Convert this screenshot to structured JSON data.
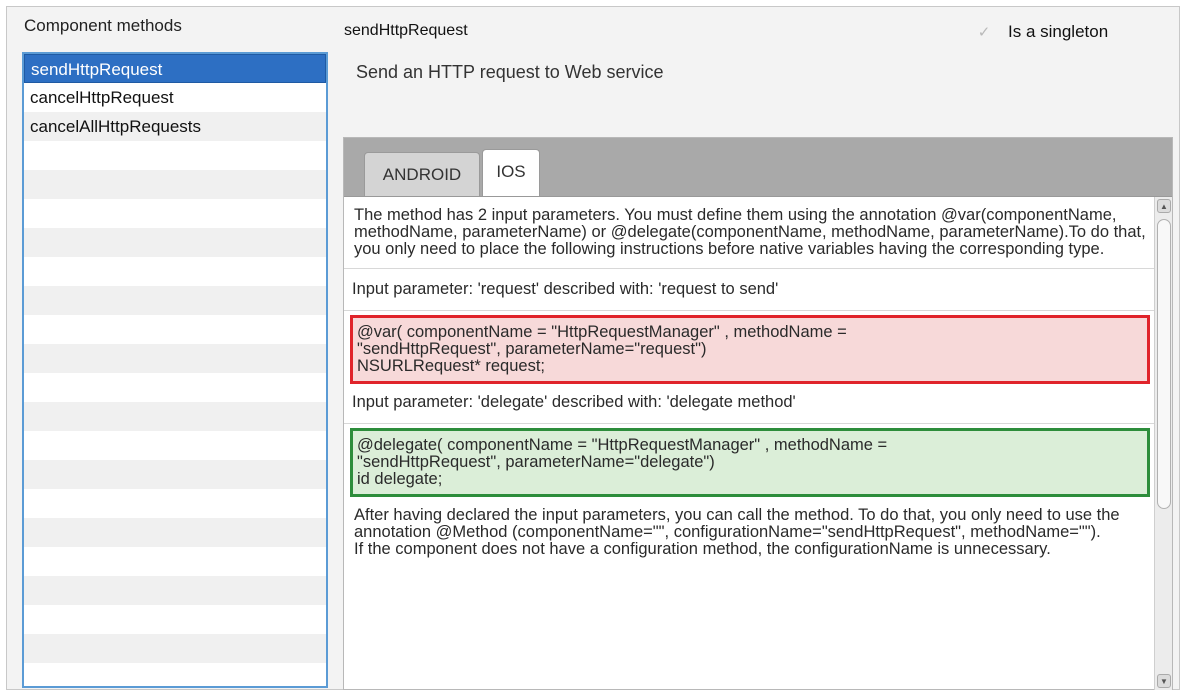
{
  "left_panel": {
    "title": "Component methods",
    "methods": [
      {
        "label": "sendHttpRequest",
        "selected": true
      },
      {
        "label": "cancelHttpRequest",
        "selected": false
      },
      {
        "label": "cancelAllHttpRequests",
        "selected": false
      }
    ]
  },
  "header": {
    "method_name": "sendHttpRequest",
    "singleton_label": "Is a singleton",
    "singleton_checked": true,
    "singleton_check_icon": "checkmark-icon"
  },
  "description": "Send an HTTP request to Web service",
  "tabs": [
    {
      "label": "ANDROID",
      "active": false
    },
    {
      "label": "IOS",
      "active": true
    }
  ],
  "content": {
    "intro": "The method has 2 input parameters. You must define them using the annotation @var(componentName, methodName, parameterName) or @delegate(componentName, methodName, parameterName).To do that, you only need to place the following instructions before native variables having the corresponding type.",
    "param1": "Input parameter: 'request' described with: 'request to send'",
    "code1_line1": "@var( componentName = \"HttpRequestManager\" , methodName =",
    "code1_line2": "\"sendHttpRequest\", parameterName=\"request\")",
    "code1_line3": "NSURLRequest* request;",
    "param2": "Input parameter: 'delegate' described with: 'delegate method'",
    "code2_line1": "@delegate( componentName = \"HttpRequestManager\" , methodName =",
    "code2_line2": "\"sendHttpRequest\", parameterName=\"delegate\")",
    "code2_line3": "id delegate;",
    "after": "After having declared the input parameters, you can call the method. To do that, you only need to use the annotation  @Method (componentName=\"\", configurationName=\"sendHttpRequest\", methodName=\"\").",
    "after2": " If the component does not have a configuration method, the configurationName is unnecessary."
  },
  "colors": {
    "selection": "#2d6fc3",
    "list_border": "#5b9bd5",
    "red_box_border": "#e0242b",
    "red_box_fill": "#f7d9d9",
    "green_box_border": "#2d8d3b",
    "green_box_fill": "#dbeed8",
    "tab_bar": "#a9a9a9"
  },
  "icons": {
    "scroll_up": "scroll-up-arrow-icon",
    "scroll_down": "scroll-down-arrow-icon"
  }
}
